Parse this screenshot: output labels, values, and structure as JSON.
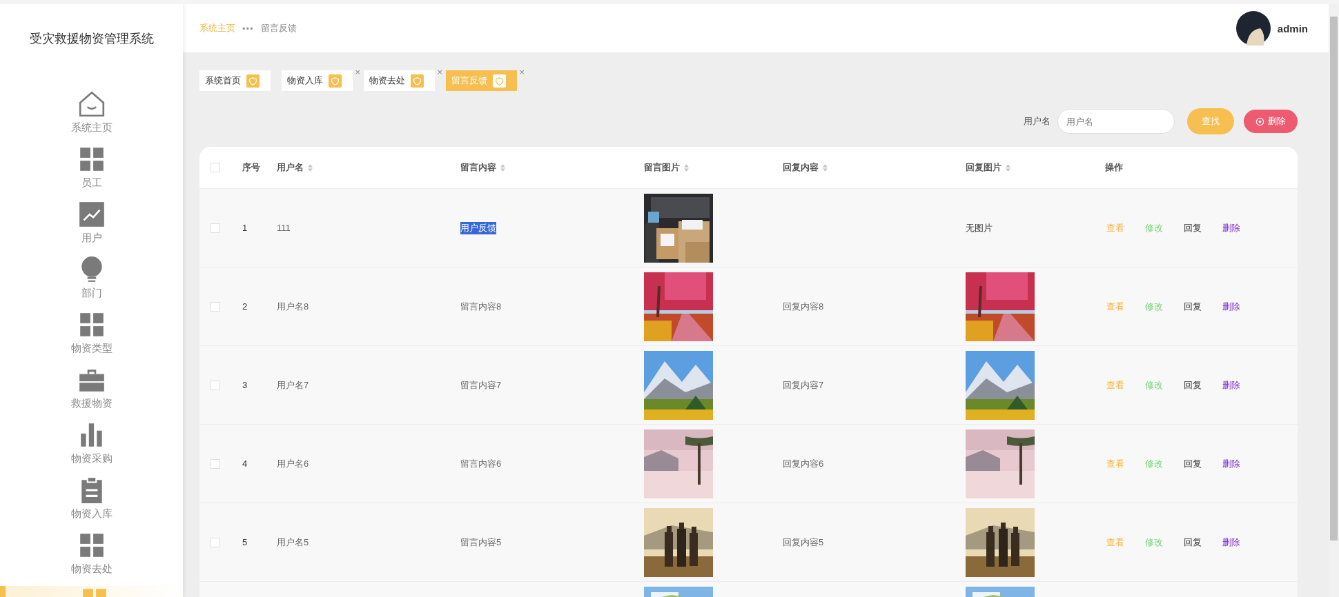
{
  "sidebar": {
    "title": "受灾救援物资管理系统",
    "items": [
      {
        "label": "系统主页",
        "selected": false
      },
      {
        "label": "员工",
        "selected": false
      },
      {
        "label": "用户",
        "selected": false
      },
      {
        "label": "部门",
        "selected": false
      },
      {
        "label": "物资类型",
        "selected": false
      },
      {
        "label": "救援物资",
        "selected": false
      },
      {
        "label": "物资采购",
        "selected": false
      },
      {
        "label": "物资入库",
        "selected": false
      },
      {
        "label": "物资去处",
        "selected": false
      },
      {
        "selected": true
      }
    ]
  },
  "header": {
    "breadcrumb": [
      {
        "label": "系统主页",
        "kind": "link"
      },
      {
        "label": "•••",
        "kind": "separator"
      },
      {
        "label": "留言反馈",
        "kind": "current"
      }
    ],
    "user": {
      "name": "admin"
    }
  },
  "tabs": [
    {
      "label": "系统首页",
      "selected": false
    },
    {
      "label": "物资入库",
      "selected": false,
      "close": "×"
    },
    {
      "label": "物资去处",
      "selected": false,
      "close": "×"
    },
    {
      "label": "留言反馈",
      "selected": true,
      "close": "×"
    }
  ],
  "search": {
    "label": "用户名",
    "placeholder": "用户名",
    "find_button": "查找",
    "delete_button": "删除"
  },
  "table": {
    "header_checked": false,
    "columns": [
      {
        "label": "序号",
        "sortable": false
      },
      {
        "label": "用户名",
        "sortable": true
      },
      {
        "label": "留言内容",
        "sortable": true
      },
      {
        "label": "留言图片",
        "sortable": true
      },
      {
        "label": "回复内容",
        "sortable": true
      },
      {
        "label": "回复图片",
        "sortable": true
      },
      {
        "label": "操作",
        "sortable": false
      }
    ],
    "rows": [
      {
        "checked": false,
        "index": "1",
        "username": "111",
        "content": "用户反馈",
        "content_selected": true,
        "image": {
          "kind": "picture"
        },
        "reply_image_text": "无图片",
        "actions": [
          {
            "label": "查看",
            "kind": "view"
          },
          {
            "label": "修改",
            "kind": "edit"
          },
          {
            "label": "回复",
            "kind": "reply"
          },
          {
            "label": "删除",
            "kind": "delete"
          }
        ]
      },
      {
        "checked": false,
        "index": "2",
        "username": "用户名8",
        "content": "留言内容8",
        "content_selected": false,
        "image": {
          "kind": "picture"
        },
        "reply": "回复内容8",
        "reply_image": {
          "kind": "picture"
        },
        "actions": [
          {
            "label": "查看",
            "kind": "view"
          },
          {
            "label": "修改",
            "kind": "edit"
          },
          {
            "label": "回复",
            "kind": "reply"
          },
          {
            "label": "删除",
            "kind": "delete"
          }
        ]
      },
      {
        "checked": false,
        "index": "3",
        "username": "用户名7",
        "content": "留言内容7",
        "content_selected": false,
        "image": {
          "kind": "picture"
        },
        "reply": "回复内容7",
        "reply_image": {
          "kind": "picture"
        },
        "actions": [
          {
            "label": "查看",
            "kind": "view"
          },
          {
            "label": "修改",
            "kind": "edit"
          },
          {
            "label": "回复",
            "kind": "reply"
          },
          {
            "label": "删除",
            "kind": "delete"
          }
        ]
      },
      {
        "checked": false,
        "index": "4",
        "username": "用户名6",
        "content": "留言内容6",
        "content_selected": false,
        "image": {
          "kind": "picture"
        },
        "reply": "回复内容6",
        "reply_image": {
          "kind": "picture"
        },
        "actions": [
          {
            "label": "查看",
            "kind": "view"
          },
          {
            "label": "修改",
            "kind": "edit"
          },
          {
            "label": "回复",
            "kind": "reply"
          },
          {
            "label": "删除",
            "kind": "delete"
          }
        ]
      },
      {
        "checked": false,
        "index": "5",
        "username": "用户名5",
        "content": "留言内容5",
        "content_selected": false,
        "image": {
          "kind": "picture"
        },
        "reply": "回复内容5",
        "reply_image": {
          "kind": "picture"
        },
        "actions": [
          {
            "label": "查看",
            "kind": "view"
          },
          {
            "label": "修改",
            "kind": "edit"
          },
          {
            "label": "回复",
            "kind": "reply"
          },
          {
            "label": "删除",
            "kind": "delete"
          }
        ]
      },
      {
        "image": {
          "kind": "picture"
        },
        "reply_image": {
          "kind": "picture"
        }
      }
    ]
  }
}
